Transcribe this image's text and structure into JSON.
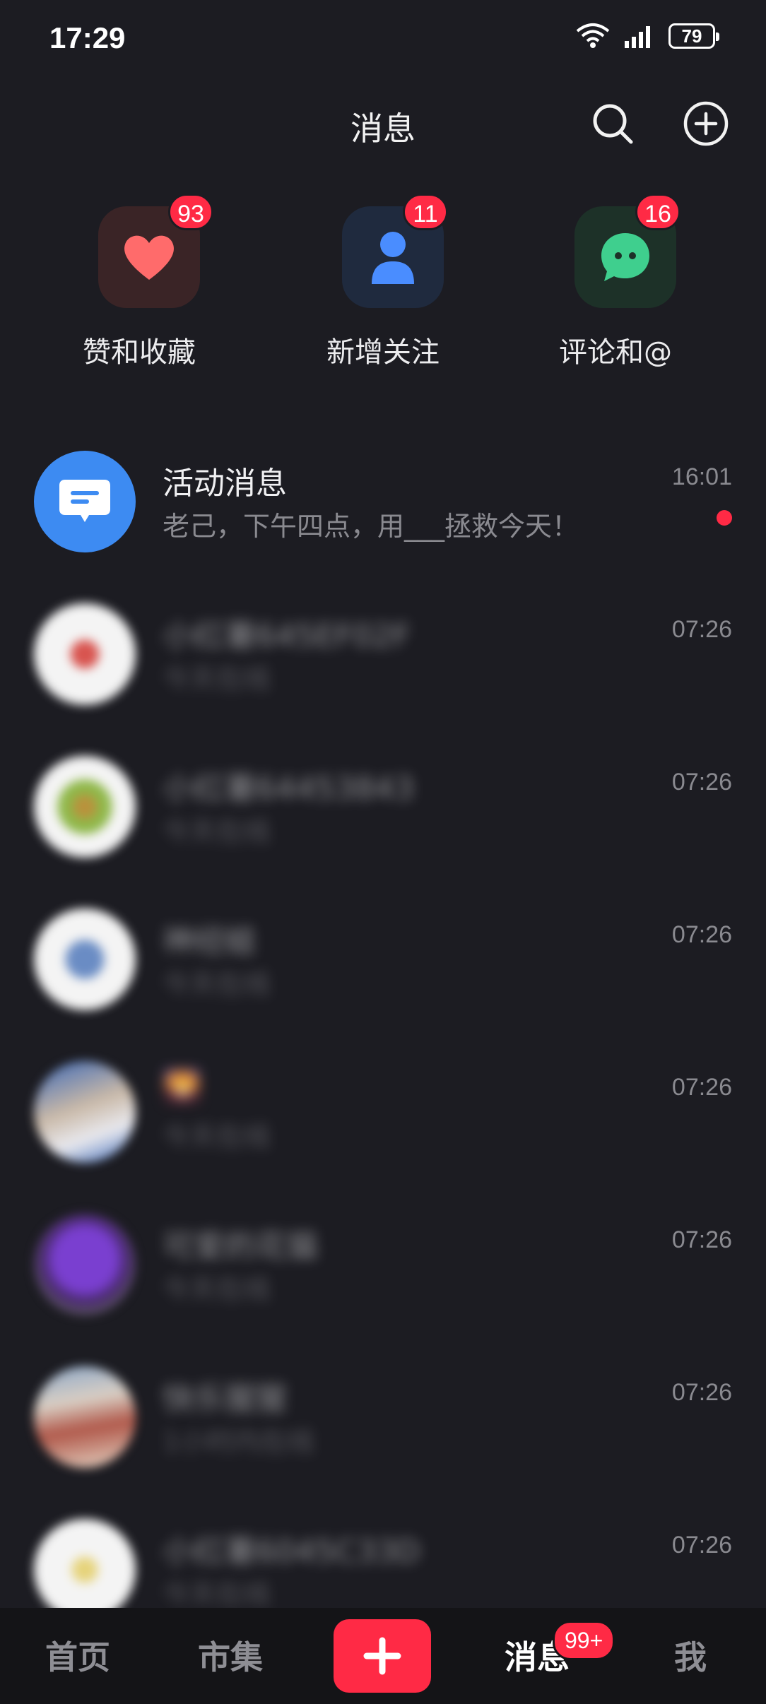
{
  "status": {
    "time": "17:29",
    "battery": "79"
  },
  "header": {
    "title": "消息"
  },
  "categories": [
    {
      "label": "赞和收藏",
      "badge": "93",
      "icon": "heart-icon",
      "color": "#ff6b6b"
    },
    {
      "label": "新增关注",
      "badge": "11",
      "icon": "person-icon",
      "color": "#4a8dff"
    },
    {
      "label": "评论和@",
      "badge": "16",
      "icon": "chat-bubble-icon",
      "color": "#3fcf8e"
    }
  ],
  "messages": [
    {
      "name": "活动消息",
      "preview": "老己，下午四点，用___拯救今天！",
      "time": "16:01",
      "unread": true
    },
    {
      "name": "小红薯645EF02F",
      "preview": "今天在线",
      "time": "07:26"
    },
    {
      "name": "小红薯64453843",
      "preview": "今天在线",
      "time": "07:26"
    },
    {
      "name": "神经蛙",
      "preview": "今天在线",
      "time": "07:26"
    },
    {
      "name": "🌄",
      "preview": "今天在线",
      "time": "07:26"
    },
    {
      "name": "可爱的花猫",
      "preview": "今天在线",
      "time": "07:26"
    },
    {
      "name": "快乐猩猩",
      "preview": "1小时内在线",
      "time": "07:26"
    },
    {
      "name": "小红薯6045C33D",
      "preview": "今天在线",
      "time": "07:26"
    }
  ],
  "tabbar": {
    "home": "首页",
    "market": "市集",
    "messages": "消息",
    "messages_badge": "99+",
    "me": "我"
  },
  "colors": {
    "accent": "#ff2a45",
    "background": "#1c1c22"
  }
}
